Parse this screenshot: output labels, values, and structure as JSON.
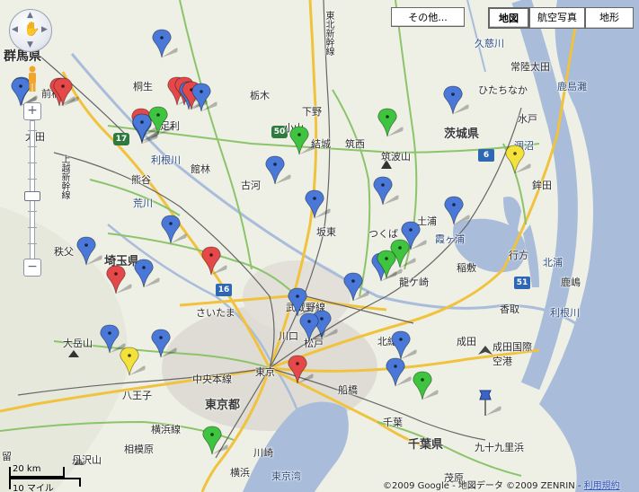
{
  "map": {
    "controls": {
      "other_label": "その他...",
      "map_label": "地図",
      "satellite_label": "航空写真",
      "terrain_label": "地形",
      "zoom_in_label": "+",
      "zoom_out_label": "−"
    },
    "scale": {
      "km_label": "20 km",
      "mile_label": "10 マイル"
    },
    "copyright": {
      "text": "©2009 Google - 地図データ ©2009 ZENRIN - ",
      "terms_link": "利用規約"
    },
    "colors": {
      "sea": "#a9bddb",
      "land": "#eef0e6",
      "urban": "#d9d7cf",
      "highway": "#f1c23e",
      "nat_road": "#8bc46a",
      "rail": "#555555"
    },
    "labels": {
      "gunma": "群馬県",
      "maebashi": "前橋",
      "kiryu": "桐生",
      "tochigi": "栃木",
      "shimotsuke": "下野",
      "oyama": "小山",
      "ashikaga": "足利",
      "ota": "太田",
      "tonegawa": "利根川",
      "tatebayashi": "館林",
      "kumagaya": "熊谷",
      "araka": "荒川",
      "koga": "古河",
      "yuki": "結城",
      "chikusei": "筑西",
      "tsukubasan": "筑波山",
      "ibaraki": "茨城県",
      "hitachinaka": "ひたちなか",
      "mito": "水戸",
      "hitachiota": "常陸太田",
      "kujigawa": "久慈川",
      "kashimanada": "鹿島灘",
      "hokota": "鉾田",
      "hinuma": "涸沼",
      "saitama_pref": "埼玉県",
      "chichibu": "秩父",
      "bando": "坂東",
      "tsukuba": "つくば",
      "tsuchiura": "土浦",
      "kasumigaura": "霞ヶ浦",
      "ryugasaki": "龍ケ崎",
      "inashiki": "稲敷",
      "namegata": "行方",
      "kitaura": "北浦",
      "katori": "香取",
      "kashima": "鹿嶋",
      "tonegawa2": "利根川",
      "saitama": "さいたま",
      "kawaguchi": "川口",
      "matsudo": "松戸",
      "musashino": "武蔵野線",
      "hokusou": "北総線",
      "narita": "成田",
      "narita_airport": "成田国際\n空港",
      "otakesan": "大岳山",
      "hachioji": "八王子",
      "chuo": "中央本線",
      "tokyo": "東京",
      "tokyoto": "東京都",
      "funabashi": "船橋",
      "chiba": "千葉",
      "chiba_pref": "千葉県",
      "kujukuri": "九十九里浜",
      "mobara": "茂原",
      "tanzawa": "丹沢山",
      "sagamihara": "相模原",
      "yokohama": "横浜",
      "kawasaki": "川崎",
      "tokyowan": "東京湾",
      "yokohama_line": "横浜線",
      "joetsu": "上越新幹線",
      "tobu": "東北本線",
      "higashikita": "東北新幹線",
      "ryo": "留"
    },
    "markers": [
      {
        "color": "blue"
      },
      {
        "color": "red"
      },
      {
        "color": "blue"
      },
      {
        "color": "red"
      },
      {
        "color": "red"
      },
      {
        "color": "blue"
      },
      {
        "color": "red"
      },
      {
        "color": "blue"
      },
      {
        "color": "blue"
      },
      {
        "color": "red"
      },
      {
        "color": "green"
      },
      {
        "color": "blue"
      },
      {
        "color": "blue"
      },
      {
        "color": "green"
      },
      {
        "color": "green"
      },
      {
        "color": "blue"
      },
      {
        "color": "blue"
      },
      {
        "color": "yellow"
      },
      {
        "color": "blue"
      },
      {
        "color": "blue"
      },
      {
        "color": "blue"
      },
      {
        "color": "blue"
      },
      {
        "color": "blue"
      },
      {
        "color": "blue"
      },
      {
        "color": "blue"
      },
      {
        "color": "green"
      },
      {
        "color": "green"
      },
      {
        "color": "blue"
      },
      {
        "color": "blue"
      },
      {
        "color": "red"
      },
      {
        "color": "blue"
      },
      {
        "color": "blue"
      },
      {
        "color": "red"
      },
      {
        "color": "blue"
      },
      {
        "color": "red"
      },
      {
        "color": "blue"
      },
      {
        "color": "blue"
      },
      {
        "color": "blue"
      },
      {
        "color": "yellow"
      },
      {
        "color": "red"
      },
      {
        "color": "blue"
      },
      {
        "color": "blue"
      },
      {
        "color": "green"
      },
      {
        "color": "blue-pushpin"
      },
      {
        "color": "green"
      }
    ],
    "route_shields": [
      "17",
      "50",
      "6",
      "51",
      "16"
    ]
  }
}
